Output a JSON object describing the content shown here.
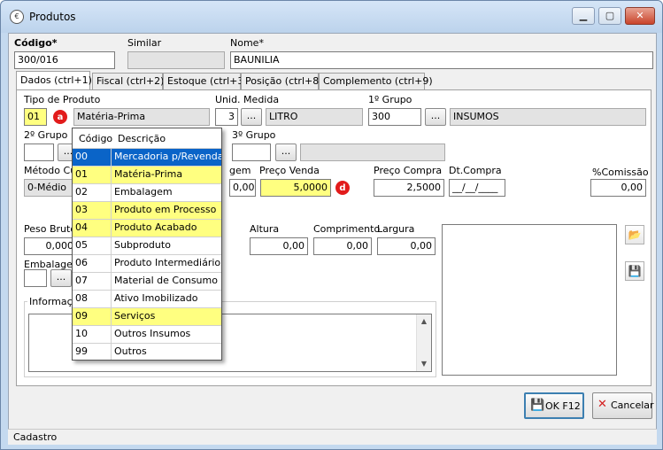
{
  "window": {
    "title": "Produtos",
    "icon": "app-logo-icon"
  },
  "header": {
    "codigo_label": "Código*",
    "codigo_value": "300/016",
    "similar_label": "Similar",
    "similar_value": "",
    "nome_label": "Nome*",
    "nome_value": "BAUNILIA"
  },
  "tabs": [
    {
      "label": "Dados (ctrl+1)"
    },
    {
      "label": "Fiscal (ctrl+2)"
    },
    {
      "label": "Estoque (ctrl+3)"
    },
    {
      "label": "Posição (ctrl+8)"
    },
    {
      "label": "Complemento (ctrl+9)"
    }
  ],
  "form": {
    "tipo_label": "Tipo de Produto",
    "tipo_code": "01",
    "tipo_desc": "Matéria-Prima",
    "unid_label": "Unid. Medida",
    "unid_code": "3",
    "unid_desc": "LITRO",
    "grupo1_label": "1º Grupo",
    "grupo1_code": "300",
    "grupo1_desc": "INSUMOS",
    "grupo2_label": "2º Grupo",
    "grupo3_label": "3º Grupo",
    "metodo_label": "Método Cus",
    "metodo_value": "0-Médio",
    "margem_label": "gem",
    "margem_value": "0,00",
    "preco_venda_label": "Preço Venda",
    "preco_venda_value": "5,0000",
    "preco_compra_label": "Preço Compra",
    "preco_compra_value": "2,5000",
    "dt_compra_label": "Dt.Compra",
    "dt_compra_value": "__/__/____",
    "comissao_label": "%Comissão",
    "comissao_value": "0,00",
    "peso_label": "Peso Bruto",
    "peso_value": "0,000",
    "altura_label": "Altura",
    "altura_value": "0,00",
    "comprimento_label": "Comprimento",
    "comprimento_value": "0,00",
    "largura_label": "Largura",
    "largura_value": "0,00",
    "embalagem_label": "Embalagem",
    "info_label": "Informaçõ",
    "dots": "..."
  },
  "badges": {
    "a": "a",
    "d": "d"
  },
  "dropdown": {
    "col_code": "Código",
    "col_desc": "Descrição",
    "rows": [
      {
        "code": "00",
        "desc": "Mercadoria p/Revenda"
      },
      {
        "code": "01",
        "desc": "Matéria-Prima"
      },
      {
        "code": "02",
        "desc": "Embalagem"
      },
      {
        "code": "03",
        "desc": "Produto em Processo"
      },
      {
        "code": "04",
        "desc": "Produto Acabado"
      },
      {
        "code": "05",
        "desc": "Subproduto"
      },
      {
        "code": "06",
        "desc": "Produto Intermediário"
      },
      {
        "code": "07",
        "desc": "Material de Consumo"
      },
      {
        "code": "08",
        "desc": "Ativo Imobilizado"
      },
      {
        "code": "09",
        "desc": "Serviços"
      },
      {
        "code": "10",
        "desc": "Outros Insumos"
      },
      {
        "code": "99",
        "desc": "Outros"
      }
    ],
    "selected_index": 0,
    "highlighted_indices": [
      1,
      3,
      4,
      9
    ],
    "colors": {
      "selected": "#0a64c8",
      "highlight": "#ffff80"
    }
  },
  "buttons": {
    "ok_label": "OK  F12",
    "cancel_label": "Cancelar"
  },
  "status": {
    "text": "Cadastro"
  }
}
